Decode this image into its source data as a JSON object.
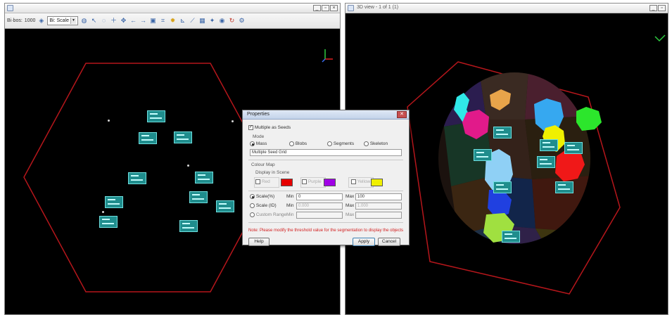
{
  "left_window": {
    "title": "",
    "toolbar": {
      "label": "Bi·bos:",
      "value_label": "1000",
      "combo_value": "Bi: Scale"
    },
    "cell_count": 10
  },
  "right_window": {
    "title": "3D view - 1 of 1 (1)"
  },
  "dialog": {
    "title": "Properties",
    "checkbox_main_label": "Multiple as Seeds",
    "radio_group_label": "Mode",
    "radio_1": "Mass",
    "radio_2": "Blobs",
    "radio_3": "Segments",
    "radio_4": "Skeleton",
    "text_field_value": "Multiple Seed Grid",
    "color_section_label": "Colour Map",
    "color_subsection_label": "Display in Scene",
    "color_opt_1": "Red",
    "color_opt_2": "Purple",
    "color_opt_3": "Yellow",
    "colors": {
      "red": "#e60000",
      "purple": "#a000e6",
      "yellow": "#f0f000"
    },
    "row1_check": "Scale(%)",
    "row1_min_label": "Min",
    "row1_min_value": "0",
    "row1_max_label": "Max",
    "row1_max_value": "100",
    "row2_check": "Scale (ID)",
    "row2_min_label": "Min",
    "row2_min_value": "0.000",
    "row2_max_label": "Max",
    "row2_max_value": "1.000",
    "row3_check": "Custom Range",
    "row3_min_label": "Min",
    "row3_max_label": "Max",
    "warning": "Note: Please modify the threshold value for the segmentation to display the objects",
    "help_button": "Help",
    "ok_button": "Apply",
    "cancel_button": "Cancel"
  }
}
